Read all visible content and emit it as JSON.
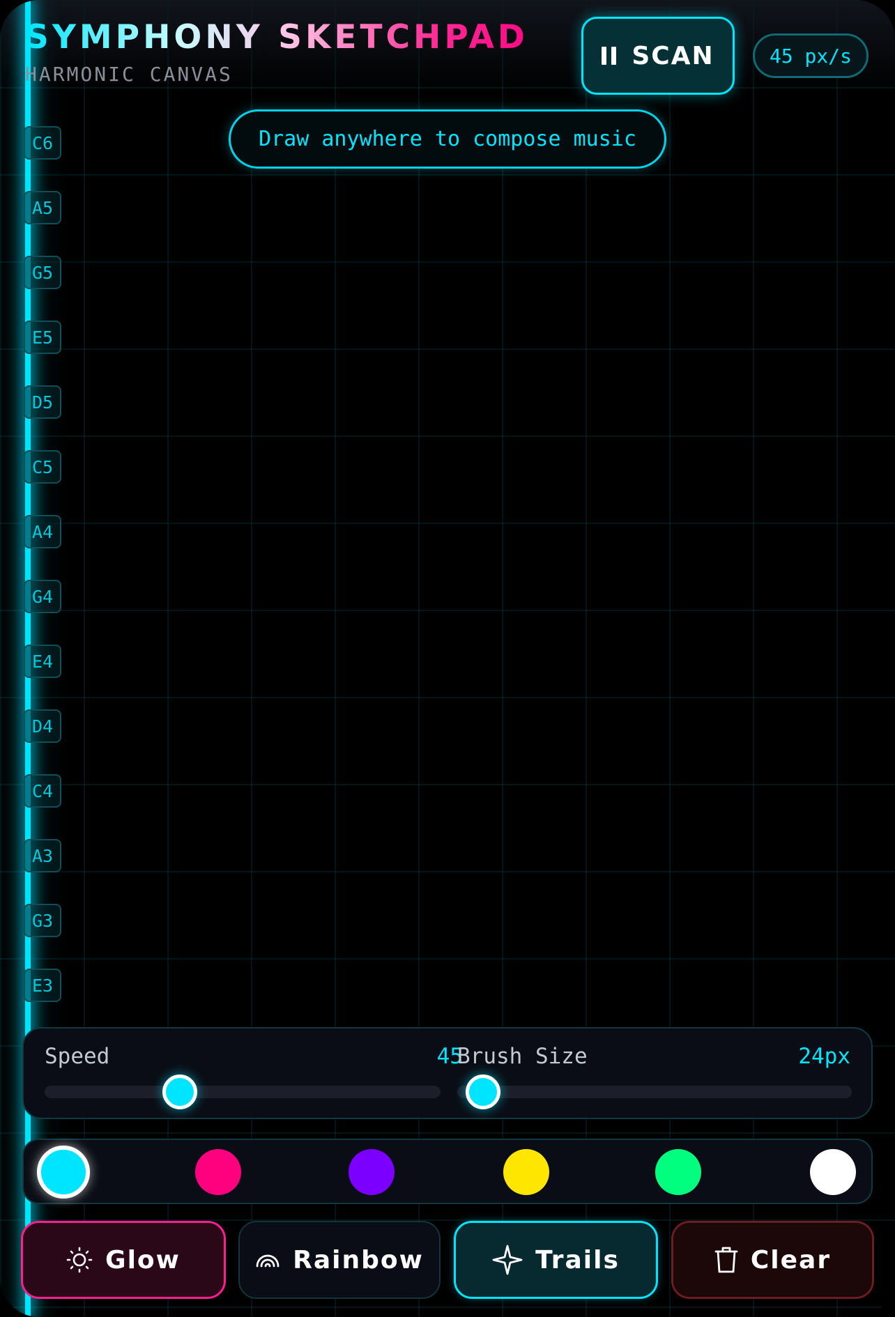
{
  "header": {
    "title": "SYMPHONY SKETCHPAD",
    "subtitle": "HARMONIC CANVAS",
    "scan_label": "SCAN",
    "speed_readout": "45 px/s"
  },
  "hint": "Draw anywhere to compose music",
  "notes": [
    "C6",
    "A5",
    "G5",
    "E5",
    "D5",
    "C5",
    "A4",
    "G4",
    "E4",
    "D4",
    "C4",
    "A3",
    "G3",
    "E3"
  ],
  "sliders": {
    "speed": {
      "label": "Speed",
      "value": "45",
      "level": 0.3
    },
    "brush": {
      "label": "Brush Size",
      "value": "24px",
      "level": 0.065
    }
  },
  "palette": {
    "colors": [
      "#00e5ff",
      "#ff007f",
      "#7c00ff",
      "#ffe600",
      "#00ff7f",
      "#ffffff"
    ],
    "selected_index": 0
  },
  "effects": {
    "glow": {
      "label": "Glow",
      "icon": "sun-icon"
    },
    "rainbow": {
      "label": "Rainbow",
      "icon": "rainbow-icon"
    },
    "trails": {
      "label": "Trails",
      "icon": "sparkle-icon"
    },
    "clear": {
      "label": "Clear",
      "icon": "trash-icon"
    }
  },
  "theme": {
    "accent": "#00e5ff",
    "pink": "#ff1f8f",
    "danger": "#6d1c22"
  }
}
